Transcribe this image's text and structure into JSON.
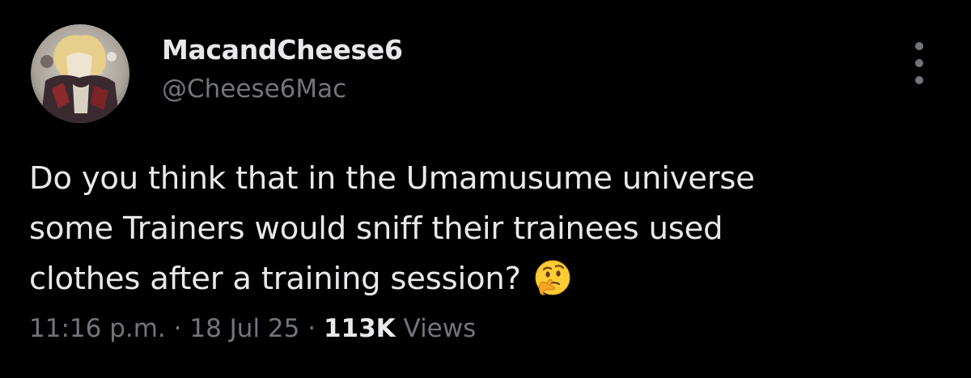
{
  "author": {
    "display_name": "MacandCheese6",
    "handle": "@Cheese6Mac"
  },
  "tweet": {
    "text_lines": [
      "Do you think that in the Umamusume universe",
      "some Trainers would sniff their trainees used",
      "clothes after a training session?"
    ],
    "emoji": "thinking-face"
  },
  "meta": {
    "time": "11:16 p.m.",
    "separator": "·",
    "date": "18 Jul 25",
    "views_count": "113K",
    "views_label": "Views"
  },
  "colors": {
    "background": "#000000",
    "primary_text": "#e7e9ea",
    "secondary_text": "#71767b"
  }
}
